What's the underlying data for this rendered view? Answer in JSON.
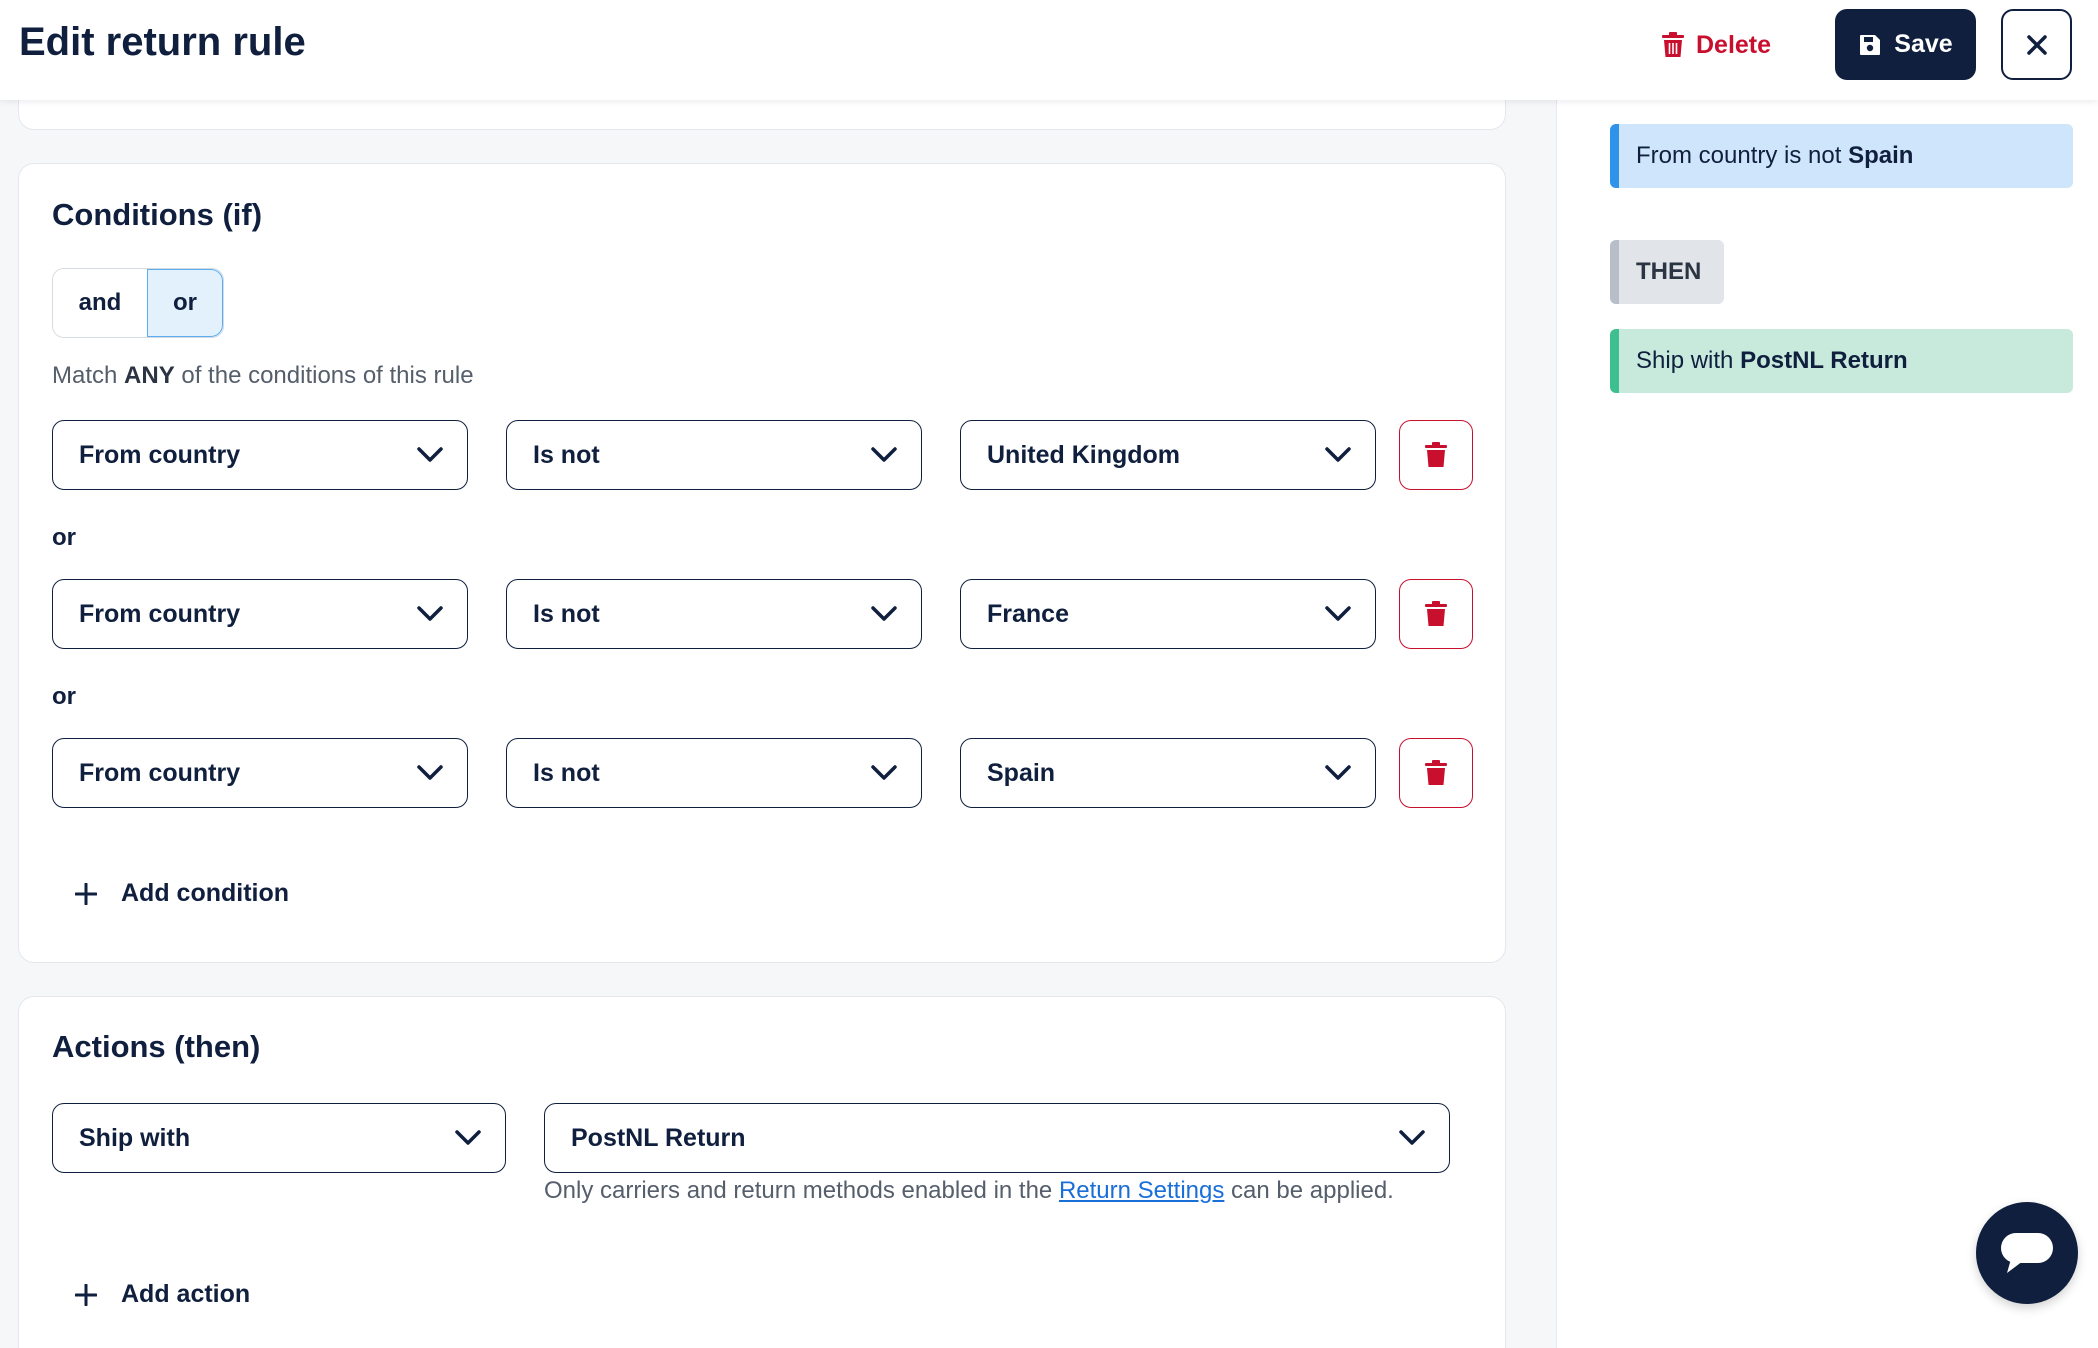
{
  "header": {
    "title": "Edit return rule",
    "delete_label": "Delete",
    "save_label": "Save"
  },
  "conditions": {
    "title": "Conditions (if)",
    "logic_options": [
      "and",
      "or"
    ],
    "logic_selected": "or",
    "match_prefix": "Match ",
    "match_emphasis": "ANY",
    "match_suffix": " of the conditions of this rule",
    "connector": "or",
    "rows": [
      {
        "field": "From country",
        "operator": "Is not",
        "value": "United Kingdom"
      },
      {
        "field": "From country",
        "operator": "Is not",
        "value": "France"
      },
      {
        "field": "From country",
        "operator": "Is not",
        "value": "Spain"
      }
    ],
    "add_label": "Add condition"
  },
  "actions": {
    "title": "Actions (then)",
    "action": "Ship with",
    "method": "PostNL Return",
    "hint_prefix": "Only carriers and return methods enabled in the ",
    "hint_link": "Return Settings",
    "hint_suffix": " can be applied.",
    "add_label": "Add action"
  },
  "summary": {
    "condition_prefix": "From country is not ",
    "condition_value": "Spain",
    "then_label": "THEN",
    "action_prefix": "Ship with ",
    "action_value": "PostNL Return"
  },
  "colors": {
    "navy": "#0f1f3d",
    "danger": "#c8102e",
    "link": "#1a6ed8",
    "condition_accent": "#2f93ea",
    "action_accent": "#3fbf8f"
  },
  "icons": [
    "trash-icon",
    "save-icon",
    "close-icon",
    "chevron-down-icon",
    "plus-icon",
    "chat-icon"
  ]
}
